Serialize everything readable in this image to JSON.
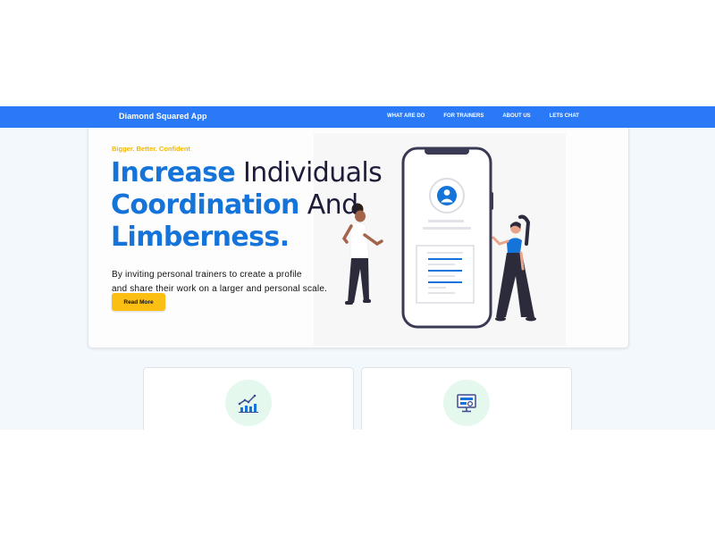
{
  "nav": {
    "brand": "Diamond Squared App",
    "links": [
      "WHAT ARE DO",
      "FOR TRAINERS",
      "ABOUT US",
      "LETS CHAT"
    ]
  },
  "hero": {
    "tagline": "Bigger. Better. Confident",
    "headline": {
      "line1_highlight": "Increase",
      "line1_rest": " Individuals",
      "line2_highlight": "Coordination",
      "line2_rest": " And",
      "line3_highlight": "Limberness."
    },
    "description_lines": [
      "By inviting personal trainers to create a profile",
      "and share their work on a larger and personal scale."
    ],
    "cta_label": "Read More"
  },
  "features": [
    {
      "icon": "chart-growth-icon"
    },
    {
      "icon": "monitor-settings-icon"
    }
  ],
  "colors": {
    "navbar": "#2a79f6",
    "accent_blue": "#1474d9",
    "accent_yellow": "#fbbf14",
    "tagline": "#f2b705",
    "icon_circle": "#e4f8ee"
  }
}
